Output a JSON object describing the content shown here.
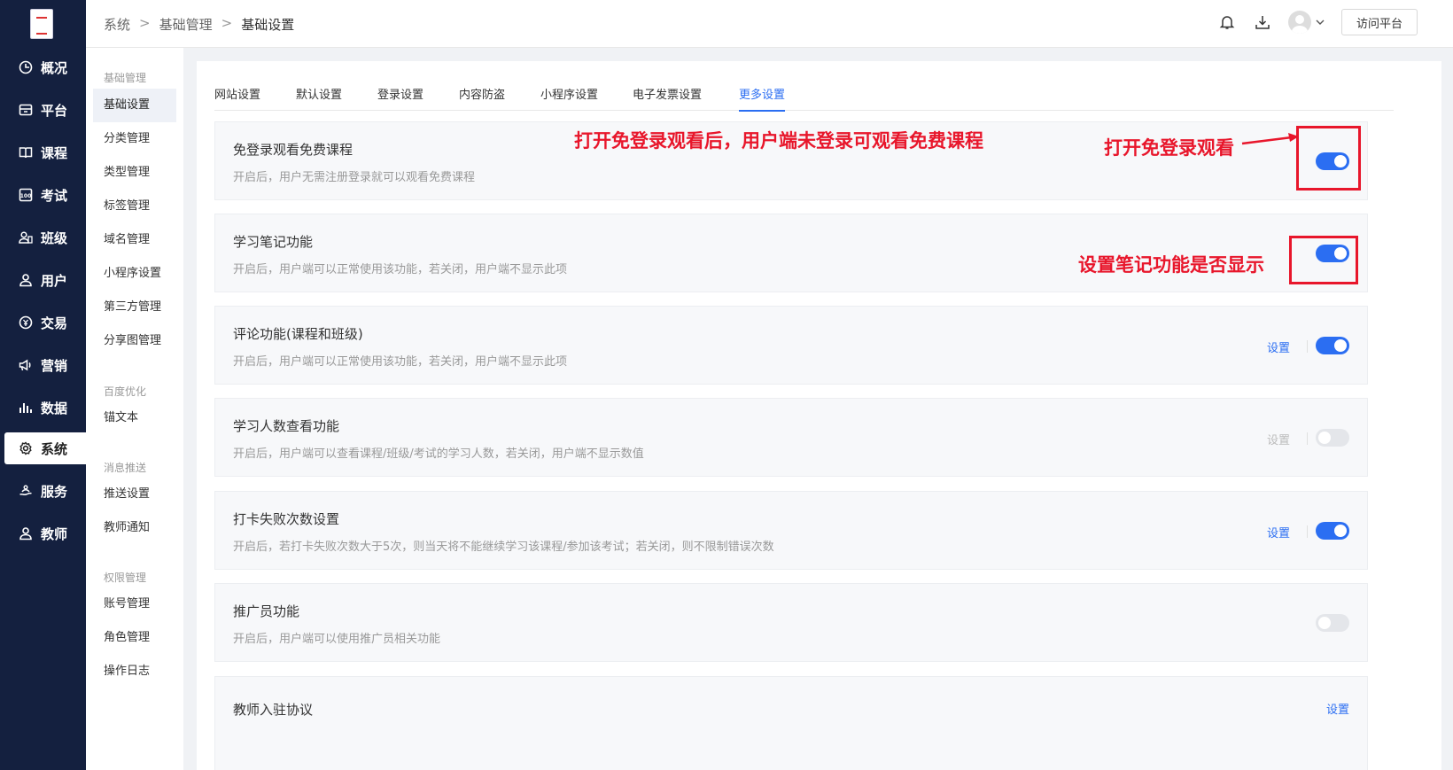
{
  "nav": {
    "items": [
      {
        "label": "概况",
        "icon": "dashboard-icon"
      },
      {
        "label": "平台",
        "icon": "platform-icon"
      },
      {
        "label": "课程",
        "icon": "book-icon"
      },
      {
        "label": "考试",
        "icon": "exam-icon"
      },
      {
        "label": "班级",
        "icon": "class-icon"
      },
      {
        "label": "用户",
        "icon": "user-icon"
      },
      {
        "label": "交易",
        "icon": "transaction-icon"
      },
      {
        "label": "营销",
        "icon": "megaphone-icon"
      },
      {
        "label": "数据",
        "icon": "chart-icon"
      },
      {
        "label": "系统",
        "icon": "gear-icon"
      },
      {
        "label": "服务",
        "icon": "service-icon"
      },
      {
        "label": "教师",
        "icon": "teacher-icon"
      }
    ],
    "active": "系统"
  },
  "submenu": {
    "groups": [
      "基础管理",
      "百度优化",
      "消息推送",
      "权限管理"
    ],
    "items": [
      "基础设置",
      "分类管理",
      "类型管理",
      "标签管理",
      "域名管理",
      "小程序设置",
      "第三方管理",
      "分享图管理",
      "锚文本",
      "推送设置",
      "教师通知",
      "账号管理",
      "角色管理",
      "操作日志"
    ],
    "active": "基础设置"
  },
  "breadcrumb": [
    "系统",
    "基础管理",
    "基础设置"
  ],
  "header": {
    "visit_label": "访问平台"
  },
  "tabs": [
    "网站设置",
    "默认设置",
    "登录设置",
    "内容防盗",
    "小程序设置",
    "电子发票设置",
    "更多设置"
  ],
  "active_tab": "更多设置",
  "settings": [
    {
      "title": "免登录观看免费课程",
      "desc": "开启后，用户无需注册登录就可以观看免费课程",
      "has_setting": false,
      "enabled": true
    },
    {
      "title": "学习笔记功能",
      "desc": "开启后，用户端可以正常使用该功能，若关闭，用户端不显示此项",
      "has_setting": false,
      "enabled": true
    },
    {
      "title": "评论功能(课程和班级)",
      "desc": "开启后，用户端可以正常使用该功能，若关闭，用户端不显示此项",
      "has_setting": true,
      "setting_label": "设置",
      "enabled": true
    },
    {
      "title": "学习人数查看功能",
      "desc": "开启后，用户端可以查看课程/班级/考试的学习人数，若关闭，用户端不显示数值",
      "has_setting": true,
      "setting_label": "设置",
      "enabled": false
    },
    {
      "title": "打卡失败次数设置",
      "desc": "开启后，若打卡失败次数大于5次，则当天将不能继续学习该课程/参加该考试；若关闭，则不限制错误次数",
      "has_setting": true,
      "setting_label": "设置",
      "enabled": true
    },
    {
      "title": "推广员功能",
      "desc": "开启后，用户端可以使用推广员相关功能",
      "has_setting": false,
      "enabled": false
    },
    {
      "title": "教师入驻协议",
      "setting_label": "设置"
    }
  ],
  "annotations": {
    "a1": "打开免登录观看后，用户端未登录可观看免费课程",
    "a2": "打开免登录观看",
    "a3": "设置笔记功能是否显示"
  },
  "colors": {
    "primary": "#2b6ef2",
    "sidebar": "#14203f",
    "annotation": "#e8162b"
  }
}
